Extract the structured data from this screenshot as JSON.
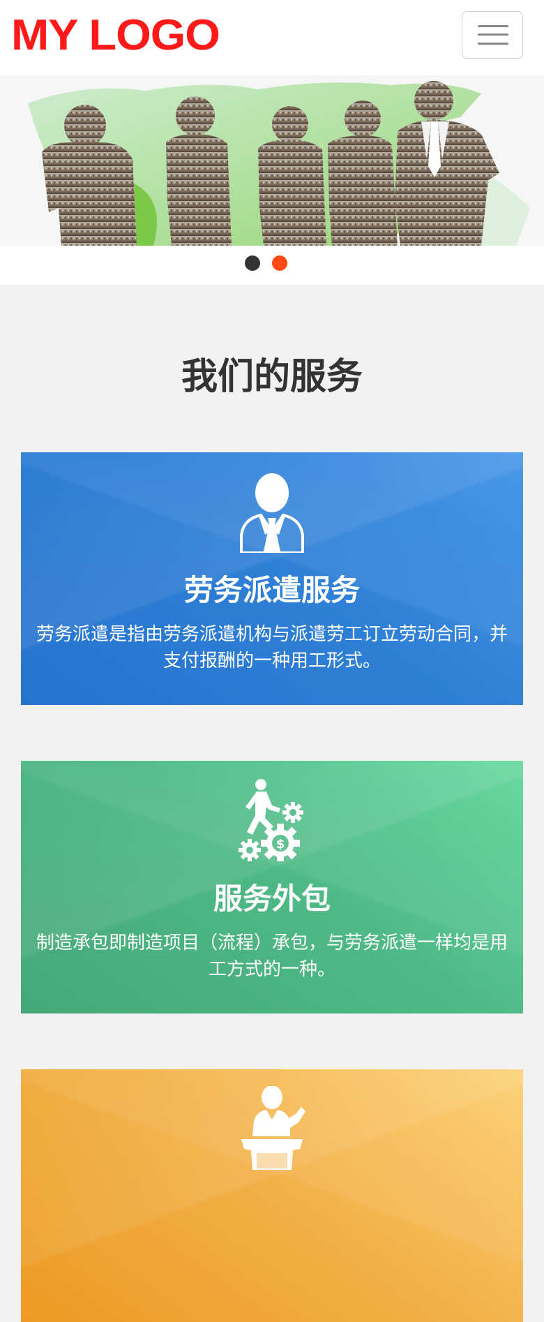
{
  "header": {
    "logo_text": "MY LOGO",
    "menu_icon": "hamburger-menu-icon"
  },
  "banner": {
    "image": "business-people-city-silhouettes",
    "slide_count": 2,
    "active_slide": 2
  },
  "services": {
    "title": "我们的服务",
    "items": [
      {
        "icon": "businessman-icon",
        "title": "劳务派遣服务",
        "description": "劳务派遣是指由劳务派遣机构与派遣劳工订立劳动合同，并支付报酬的一种用工形式。",
        "color": "#2f80d6"
      },
      {
        "icon": "person-gears-icon",
        "title": "服务外包",
        "description": "制造承包即制造项目（流程）承包，与劳务派遣一样均是用工方式的一种。",
        "color": "#4fba86"
      },
      {
        "icon": "speaker-podium-icon",
        "title": "",
        "description": "",
        "color": "#f3b24a"
      }
    ]
  },
  "colors": {
    "logo": "#ff1a1a",
    "active_dot": "#ff4a14",
    "inactive_dot": "#333333",
    "page_bg": "#f2f2f2"
  }
}
